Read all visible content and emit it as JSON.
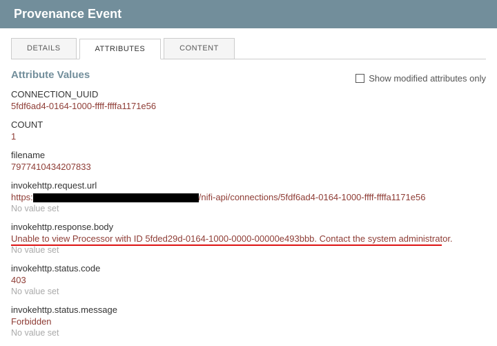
{
  "header": {
    "title": "Provenance Event"
  },
  "tabs": {
    "details": "DETAILS",
    "attributes": "ATTRIBUTES",
    "content": "CONTENT"
  },
  "section": {
    "title": "Attribute Values",
    "show_modified_label": "Show modified attributes only"
  },
  "no_value": "No value set",
  "attrs": {
    "connection_uuid": {
      "name": "CONNECTION_UUID",
      "value": "5fdf6ad4-0164-1000-ffff-ffffa1171e56"
    },
    "count": {
      "name": "COUNT",
      "value": "1"
    },
    "filename": {
      "name": "filename",
      "value": "7977410434207833"
    },
    "request_url": {
      "name": "invokehttp.request.url",
      "prefix": "https:",
      "suffix": "/nifi-api/connections/5fdf6ad4-0164-1000-ffff-ffffa1171e56"
    },
    "response_body": {
      "name": "invokehttp.response.body",
      "value": "Unable to view Processor with ID 5fded29d-0164-1000-0000-00000e493bbb. Contact the system administrator."
    },
    "status_code": {
      "name": "invokehttp.status.code",
      "value": "403"
    },
    "status_message": {
      "name": "invokehttp.status.message",
      "value": "Forbidden"
    }
  }
}
